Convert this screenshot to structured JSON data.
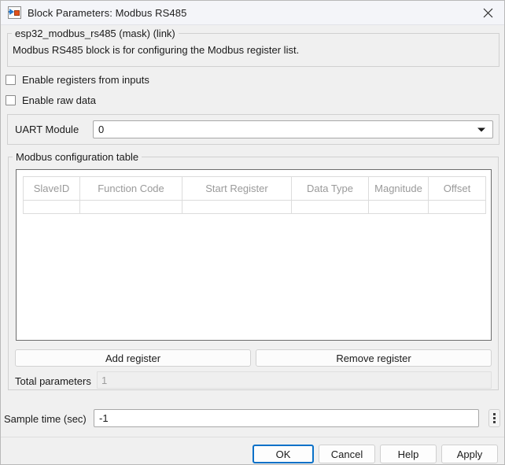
{
  "window": {
    "title": "Block Parameters: Modbus RS485",
    "icon": "simulink-block-icon",
    "close_icon": "close-icon"
  },
  "description": {
    "legend": "esp32_modbus_rs485 (mask) (link)",
    "body": "Modbus RS485 block is for configuring the Modbus register list."
  },
  "checkboxes": [
    {
      "label": "Enable registers from inputs",
      "checked": false
    },
    {
      "label": "Enable raw data",
      "checked": false
    }
  ],
  "uart": {
    "label": "UART Module",
    "value": "0",
    "arrow_icon": "chevron-down-icon",
    "options": [
      "0"
    ]
  },
  "modbus_table": {
    "legend": "Modbus configuration table",
    "columns": [
      "SlaveID",
      "Function Code",
      "Start Register",
      "Data Type",
      "Magnitude",
      "Offset"
    ],
    "rows": [],
    "add_button": "Add register",
    "remove_button": "Remove register",
    "total_label": "Total parameters",
    "total_value": "1"
  },
  "sample_time": {
    "label": "Sample time (sec)",
    "value": "-1",
    "more_icon": "vertical-ellipsis-icon"
  },
  "dialog_buttons": [
    {
      "label": "OK",
      "default": true
    },
    {
      "label": "Cancel",
      "default": false
    },
    {
      "label": "Help",
      "default": false
    },
    {
      "label": "Apply",
      "default": false
    }
  ],
  "colors": {
    "titlebar": "#f4f5f9",
    "body": "#f0f0f0",
    "default_button_border": "#0a71c8",
    "icon_blue": "#2878c8",
    "icon_orange": "#e2521b",
    "muted_text": "#9a9a9a"
  }
}
